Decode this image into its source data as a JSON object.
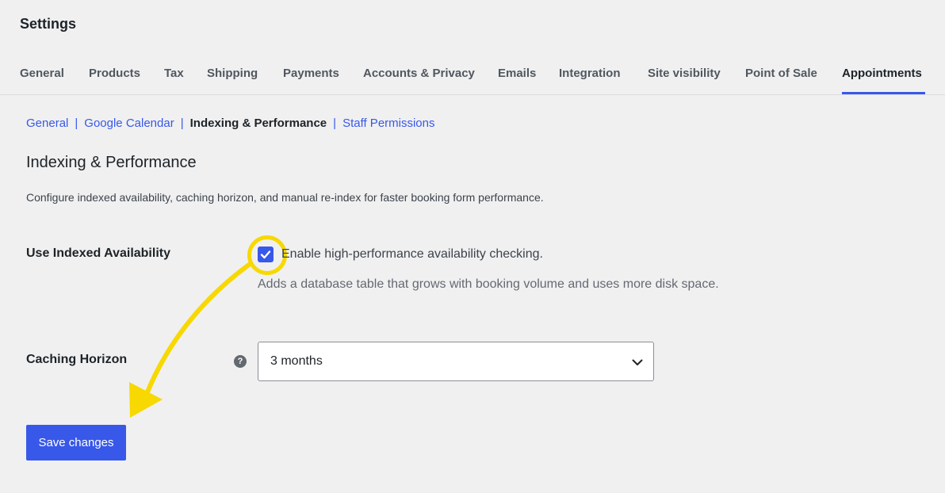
{
  "header": {
    "title": "Settings"
  },
  "tabs": [
    {
      "label": "General"
    },
    {
      "label": "Products"
    },
    {
      "label": "Tax"
    },
    {
      "label": "Shipping"
    },
    {
      "label": "Payments"
    },
    {
      "label": "Accounts & Privacy"
    },
    {
      "label": "Emails"
    },
    {
      "label": "Integration"
    },
    {
      "label": "Site visibility"
    },
    {
      "label": "Point of Sale"
    },
    {
      "label": "Appointments",
      "active": true
    }
  ],
  "subnav": {
    "items": [
      {
        "label": "General"
      },
      {
        "label": "Google Calendar"
      },
      {
        "label": "Indexing & Performance",
        "current": true
      },
      {
        "label": "Staff Permissions"
      }
    ],
    "separator": "|"
  },
  "section": {
    "title": "Indexing & Performance",
    "description": "Configure indexed availability, caching horizon, and manual re-index for faster booking form performance."
  },
  "indexed_availability": {
    "label": "Use Indexed Availability",
    "checked": true,
    "checkbox_label": "Enable high-performance availability checking.",
    "description": "Adds a database table that grows with booking volume and uses more disk space."
  },
  "caching_horizon": {
    "label": "Caching Horizon",
    "help_icon": "?",
    "selected": "3 months"
  },
  "save_label": "Save changes",
  "colors": {
    "accent": "#3858e9",
    "annotation": "#f7d800",
    "background": "#f0f0f1"
  }
}
